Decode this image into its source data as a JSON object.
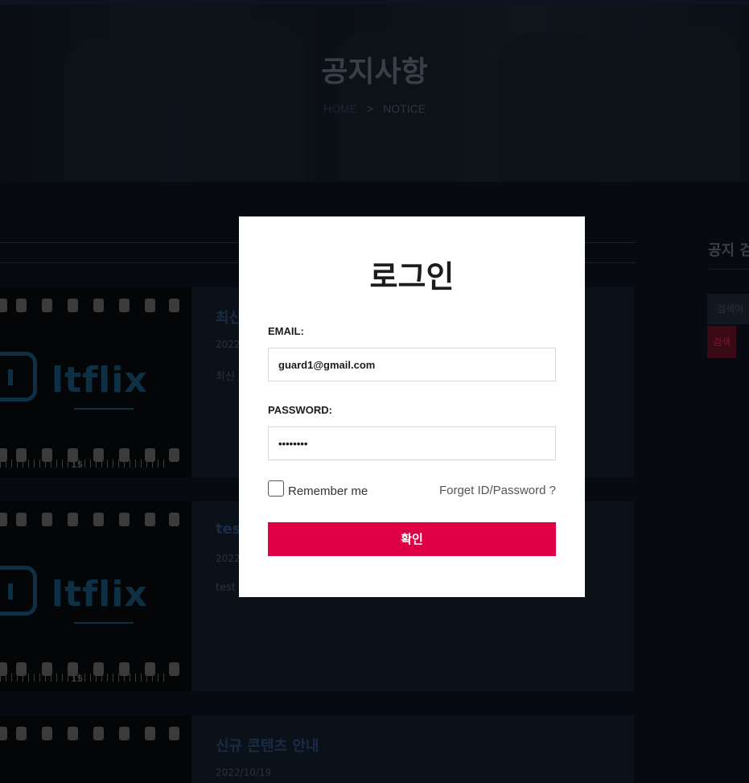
{
  "page": {
    "hero_title": "공지사항",
    "breadcrumb": {
      "home": "HOME",
      "separator": ">",
      "current": "NOTICE"
    }
  },
  "notices": [
    {
      "title": "최신",
      "date": "2022",
      "excerpt": "최신",
      "thumb_brand": "ltflix",
      "thumb_num": "15"
    },
    {
      "title": "test",
      "date": "2022",
      "excerpt": "test",
      "thumb_brand": "ltflix",
      "thumb_num": "15"
    },
    {
      "title": "신규 콘텐츠 안내",
      "date": "2022/10/19",
      "excerpt": "",
      "thumb_brand": "",
      "thumb_num": ""
    }
  ],
  "sidebar": {
    "title": "공지 검",
    "search_placeholder": "검색어",
    "search_button": "검색"
  },
  "login_modal": {
    "title": "로그인",
    "email_label": "EMAIL:",
    "email_value": "guard1@gmail.com",
    "password_label": "PASSWORD:",
    "password_value": "••••••••",
    "remember_label": "Remember me",
    "forget_link": "Forget ID/Password ?",
    "submit_label": "확인"
  },
  "colors": {
    "accent": "#e00045",
    "background": "#070b11",
    "modal_bg": "#ffffff"
  }
}
